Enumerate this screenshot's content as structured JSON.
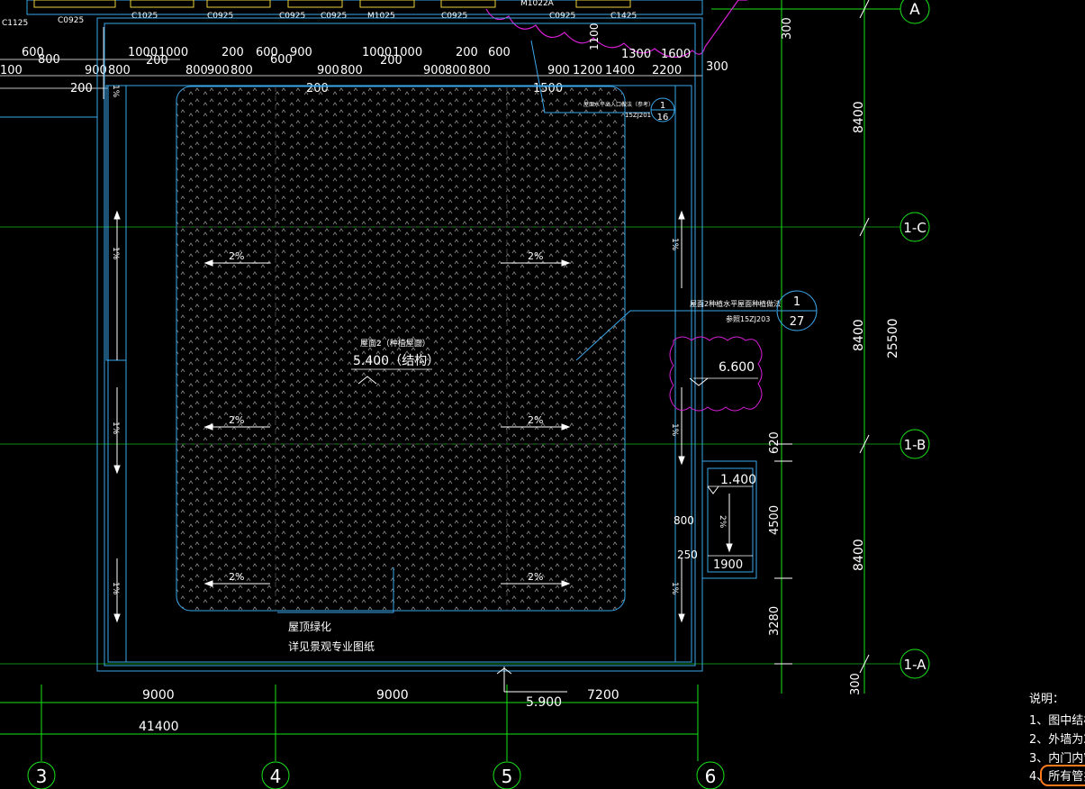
{
  "colors": {
    "background": "#000000",
    "axis": "#19e619",
    "wall": "#3aa6e8",
    "text": "#ffffff",
    "cloud": "#d61fd6",
    "dim": "#ffffff",
    "highlight": "#ff7a1a",
    "window": "#e8d23a"
  },
  "axes": {
    "horizontal": [
      "A",
      "1-C",
      "1-B",
      "1-A"
    ],
    "vertical": [
      "3",
      "4",
      "5",
      "6"
    ]
  },
  "window_labels": [
    "C1125",
    "C0925",
    "C1025",
    "C0925",
    "C0925",
    "C0925",
    "M1025",
    "C0925",
    "M1022A",
    "C0925",
    "C1425"
  ],
  "top_dims_row1": [
    "600",
    "1000",
    "1000",
    "200",
    "600",
    "900",
    "1000",
    "1000",
    "200",
    "600"
  ],
  "top_dims_row2": [
    "100",
    "800",
    "900",
    "800",
    "800",
    "900",
    "800",
    "900",
    "800",
    "900",
    "800",
    "800",
    "900",
    "900",
    "1200",
    "1400",
    "2200"
  ],
  "top_misc": {
    "d200a": "200",
    "d200b": "200",
    "d200c": "200",
    "d600": "600",
    "d200d": "200",
    "d1300": "1300",
    "d1600": "1600",
    "d300": "300",
    "d1100": "1100",
    "d1500": "1500"
  },
  "right_dims": {
    "d300_top": "300",
    "d8400_a": "8400",
    "d8400_b": "8400",
    "d8400_c": "8400",
    "d25500": "25500",
    "d620": "620",
    "d4500": "4500",
    "d3280": "3280",
    "d300_bot": "300"
  },
  "bottom_dims": {
    "d9000_a": "9000",
    "d9000_b": "9000",
    "d7200": "7200",
    "d41400": "41400"
  },
  "slopes": {
    "two": "2%",
    "one": "1%"
  },
  "elevations": {
    "roof": "5.400（结构）",
    "bay": "6.600",
    "side": "1.400",
    "bottom": "5.900"
  },
  "roof_note_small": "屋面2（种植屋面）",
  "green_roof_note": [
    "屋顶绿化",
    "详见景观专业图纸"
  ],
  "detail_callouts": {
    "top": {
      "num": "1",
      "sheet": "16",
      "ref": "15ZJ201",
      "note": "屋面水平出入口做法（参考）"
    },
    "mid": {
      "num": "1",
      "sheet": "27",
      "ref": "参照15ZJ203",
      "note": "屋面2种植水平屋面种植做法"
    }
  },
  "small_dims": {
    "d800": "800",
    "d250": "250",
    "d1900": "1900",
    "slope_side": "2%"
  },
  "notes": {
    "title": "说明：",
    "items": [
      "1、图中结构",
      "2、外墙为20",
      "3、内门内窗",
      "4、所有管井"
    ]
  }
}
